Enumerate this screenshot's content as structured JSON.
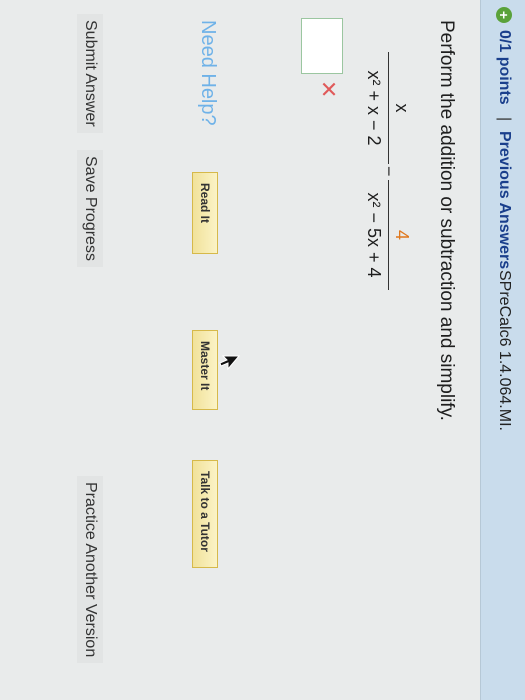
{
  "header": {
    "points": "0/1 points",
    "separator": "|",
    "previous_answers": "Previous Answers",
    "source": "SPreCalc6 1.4.064.MI."
  },
  "question": {
    "prompt": "Perform the addition or subtraction and simplify.",
    "frac1_num": "x",
    "frac1_den": "x² + x − 2",
    "operator": "−",
    "frac2_num": "4",
    "frac2_den": "x² − 5x + 4",
    "wrong_mark": "✕"
  },
  "help": {
    "label": "Need Help?",
    "read": "Read It",
    "master": "Master It",
    "tutor": "Talk to a Tutor"
  },
  "footer": {
    "submit": "Submit Answer",
    "save": "Save Progress",
    "practice": "Practice Another Version"
  },
  "icons": {
    "points": "plus-circle-icon",
    "cursor": "mouse-cursor-icon"
  },
  "colors": {
    "link": "#1a3f8c",
    "accent_orange": "#e0781d",
    "error": "#e05a5a",
    "help": "#6fb2e8"
  }
}
